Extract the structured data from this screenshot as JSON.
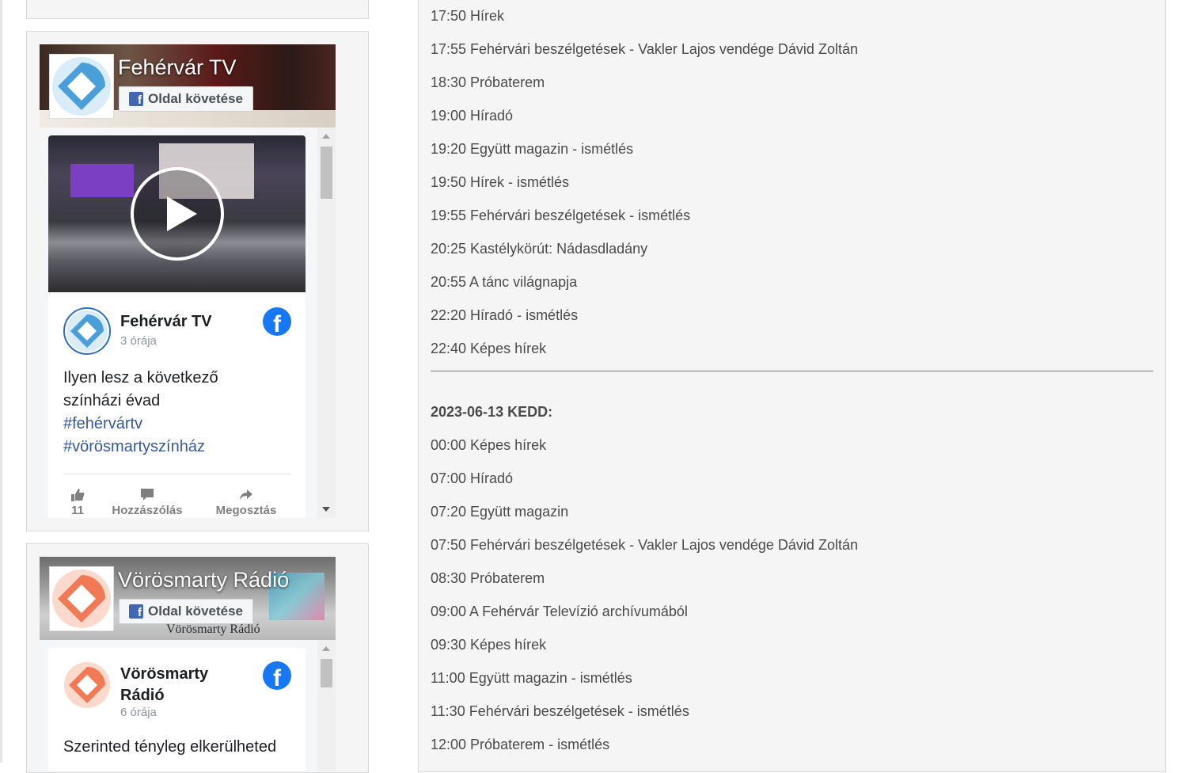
{
  "widgets": [
    {
      "page_name": "Fehérvár TV",
      "follow_label": "Oldal követése",
      "post": {
        "author": "Fehérvár TV",
        "time": "3 órája",
        "text_lines": [
          "Ilyen lesz a következő",
          "színházi évad"
        ],
        "hashtags": [
          "#fehérvártv",
          "#vörösmartyszínház"
        ],
        "actions": {
          "like_count": "11",
          "comment": "Hozzászólás",
          "share": "Megosztás"
        }
      },
      "brand_color": "#4a9fd8"
    },
    {
      "page_name": "Vörösmarty Rádió",
      "follow_label": "Oldal követése",
      "cover_script": "Vörösmarty Rádió",
      "post": {
        "author_line1": "Vörösmarty",
        "author_line2": "Rádió",
        "time": "6 órája",
        "text_first_line": "Szerinted tényleg elkerülheted"
      },
      "brand_color": "#f07a55"
    }
  ],
  "schedule": {
    "items_top": [
      "17:50 Hírek",
      "17:55 Fehérvári beszélgetések - Vakler Lajos vendége Dávid Zoltán",
      "18:30 Próbaterem",
      "19:00 Híradó",
      "19:20 Együtt magazin - ismétlés",
      "19:50 Hírek - ismétlés",
      "19:55 Fehérvári beszélgetések - ismétlés",
      "20:25 Kastélykörút: Nádasdladány",
      "20:55 A tánc világnapja",
      "22:20 Híradó - ismétlés",
      "22:40 Képes hírek"
    ],
    "day_heading": "2023-06-13 KEDD:",
    "items_day": [
      "00:00 Képes hírek",
      "07:00 Híradó",
      "07:20 Együtt magazin",
      "07:50 Fehérvári beszélgetések - Vakler Lajos vendége Dávid Zoltán",
      "08:30 Próbaterem",
      "09:00 A Fehérvár Televízió archívumából",
      "09:30 Képes hírek",
      "11:00 Együtt magazin - ismétlés",
      "11:30 Fehérvári beszélgetések - ismétlés",
      "12:00 Próbaterem - ismétlés"
    ]
  }
}
